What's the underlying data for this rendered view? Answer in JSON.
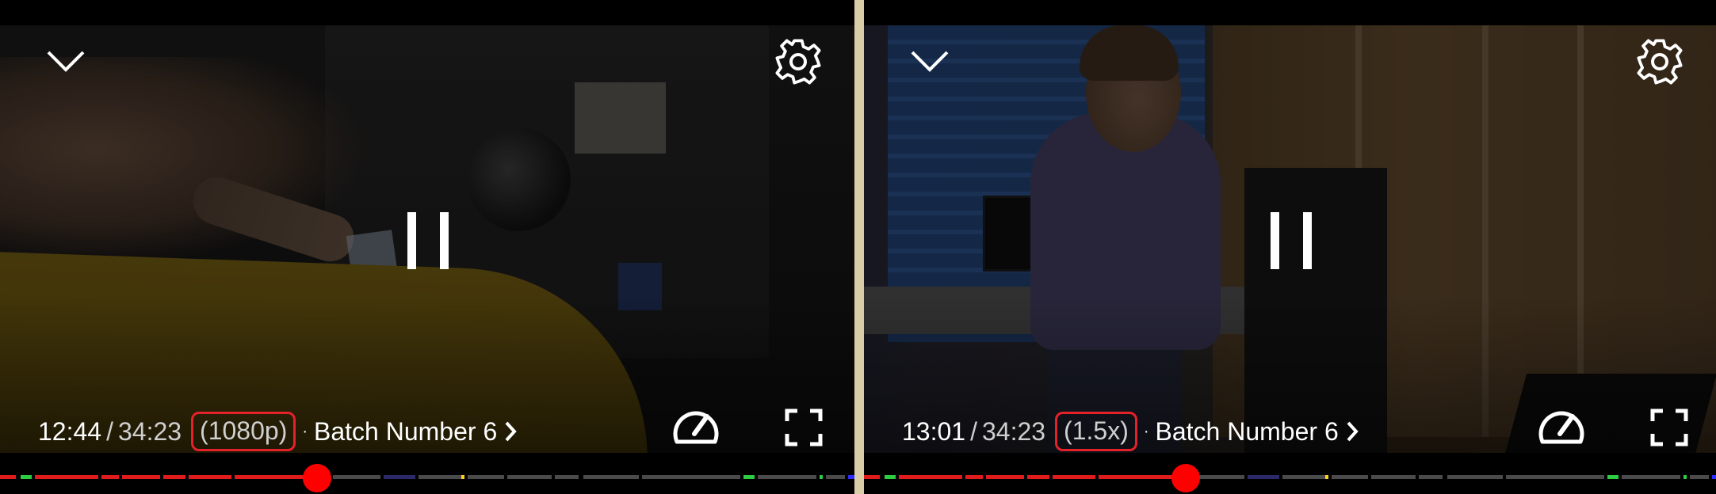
{
  "colors": {
    "accent_red": "#ff0000",
    "highlight_box": "#e5222a",
    "divider": "#d9cda8",
    "played": "#e01b1b",
    "unplayed": "#4a4a4a",
    "chapter_green": "#2ecc40",
    "chapter_yellow": "#ffd21a",
    "chapter_blue": "#2a2aff"
  },
  "panels": [
    {
      "id": "left",
      "icons": {
        "minimize": "chevron-down-icon",
        "settings": "gear-icon",
        "playback": "pause-icon",
        "speed": "speedometer-icon",
        "fullscreen": "fullscreen-icon"
      },
      "current_time": "12:44",
      "separator": "/",
      "total_time": "34:23",
      "tag": "(1080p)",
      "dot": "·",
      "episode_title": "Batch Number 6",
      "progress_fraction": 0.37
    },
    {
      "id": "right",
      "icons": {
        "minimize": "chevron-down-icon",
        "settings": "gear-icon",
        "playback": "pause-icon",
        "speed": "speedometer-icon",
        "fullscreen": "fullscreen-icon"
      },
      "current_time": "13:01",
      "separator": "/",
      "total_time": "34:23",
      "tag": "(1.5x)",
      "dot": "·",
      "episode_title": "Batch Number 6",
      "progress_fraction": 0.38
    }
  ]
}
